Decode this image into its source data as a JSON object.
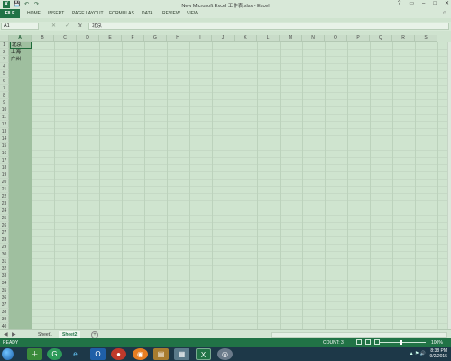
{
  "window": {
    "title": "New Microsoft Excel 工作表.xlsx - Excel",
    "controls": [
      "?",
      "▭",
      "–",
      "□",
      "✕"
    ]
  },
  "qat": {
    "app_icon_label": "X",
    "save": "💾",
    "undo": "↶",
    "redo": "↷"
  },
  "ribbon": {
    "file": "FILE",
    "tabs": [
      "HOME",
      "INSERT",
      "PAGE LAYOUT",
      "FORMULAS",
      "DATA",
      "REVIEW",
      "VIEW"
    ],
    "right": "☺"
  },
  "formula_bar": {
    "name_box": "A1",
    "cancel": "✕",
    "enter": "✓",
    "fx": "fx",
    "value": "北京"
  },
  "grid": {
    "columns": [
      "A",
      "B",
      "C",
      "D",
      "E",
      "F",
      "G",
      "H",
      "I",
      "J",
      "K",
      "L",
      "M",
      "N",
      "O",
      "P",
      "Q",
      "R",
      "S"
    ],
    "rows": [
      "1",
      "2",
      "3",
      "4",
      "5",
      "6",
      "7",
      "8",
      "9",
      "10",
      "11",
      "12",
      "13",
      "14",
      "15",
      "16",
      "17",
      "18",
      "19",
      "20",
      "21",
      "22",
      "23",
      "24",
      "25",
      "26",
      "27",
      "28",
      "29",
      "30",
      "31",
      "32",
      "33",
      "34",
      "35",
      "36",
      "37",
      "38",
      "39",
      "40"
    ],
    "cells": {
      "A1": "北京",
      "A2": "上海",
      "A3": "广州"
    }
  },
  "sheets": {
    "nav_prev": "◀",
    "nav_next": "▶",
    "tabs": [
      "Sheet1",
      "Sheet2"
    ],
    "active": "Sheet2",
    "add": "+"
  },
  "status": {
    "ready": "READY",
    "count": "COUNT: 3",
    "zoom": "100%"
  },
  "taskbar": {
    "clock_time": "8:38 PM",
    "clock_date": "9/2/2015",
    "tray": "▲ ⚑ 🔊"
  },
  "colors": {
    "excel_green": "#217346",
    "grid_bg": "#cfe4cf"
  }
}
